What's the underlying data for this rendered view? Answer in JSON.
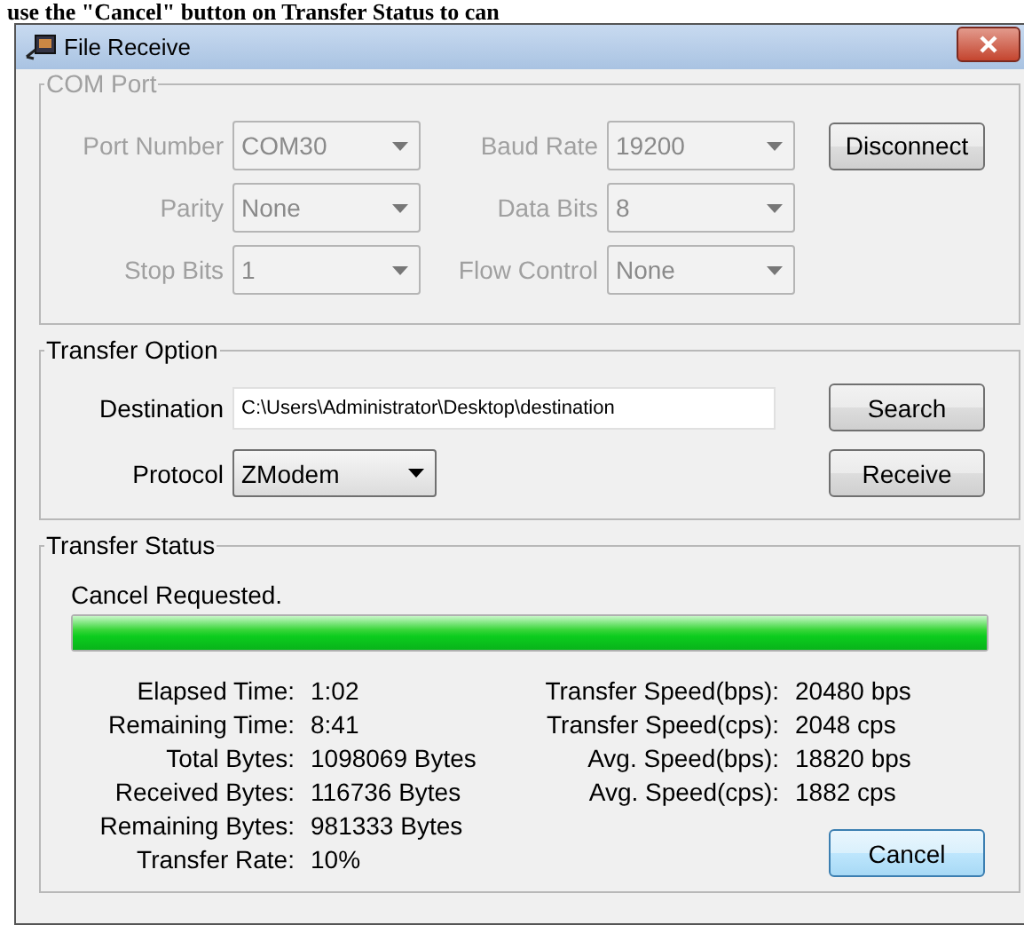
{
  "page_text": "use the \"Cancel\" button on Transfer Status to can",
  "window": {
    "title": "File Receive"
  },
  "com_port": {
    "title": "COM Port",
    "disabled": true,
    "fields": [
      {
        "label": "Port Number",
        "value": "COM30"
      },
      {
        "label": "Baud Rate",
        "value": "19200"
      },
      {
        "label": "Parity",
        "value": "None"
      },
      {
        "label": "Data Bits",
        "value": "8"
      },
      {
        "label": "Stop Bits",
        "value": "1"
      },
      {
        "label": "Flow Control",
        "value": "None"
      }
    ],
    "button": "Disconnect"
  },
  "transfer_option": {
    "title": "Transfer Option",
    "destination": {
      "label": "Destination",
      "value": "C:\\Users\\Administrator\\Desktop\\destination"
    },
    "protocol": {
      "label": "Protocol",
      "value": "ZModem"
    },
    "buttons": [
      "Search",
      "Receive"
    ]
  },
  "transfer_status": {
    "title": "Transfer Status",
    "message": "Cancel Requested.",
    "progress": {
      "level": 1
    },
    "left": [
      {
        "label": "Elapsed Time:",
        "value": "1:02"
      },
      {
        "label": "Remaining Time:",
        "value": "8:41"
      },
      {
        "label": "Total Bytes:",
        "value": "1098069 Bytes"
      },
      {
        "label": "Received Bytes:",
        "value": "116736 Bytes"
      },
      {
        "label": "Remaining Bytes:",
        "value": "981333 Bytes"
      },
      {
        "label": "Transfer Rate:",
        "value": "10%"
      }
    ],
    "right": [
      {
        "label": "Transfer Speed(bps):",
        "value": "20480 bps"
      },
      {
        "label": "Transfer Speed(cps):",
        "value": "2048 cps"
      },
      {
        "label": "Avg. Speed(bps):",
        "value": "18820 bps"
      },
      {
        "label": "Avg. Speed(cps):",
        "value": "1882 cps"
      }
    ],
    "button": "Cancel"
  }
}
